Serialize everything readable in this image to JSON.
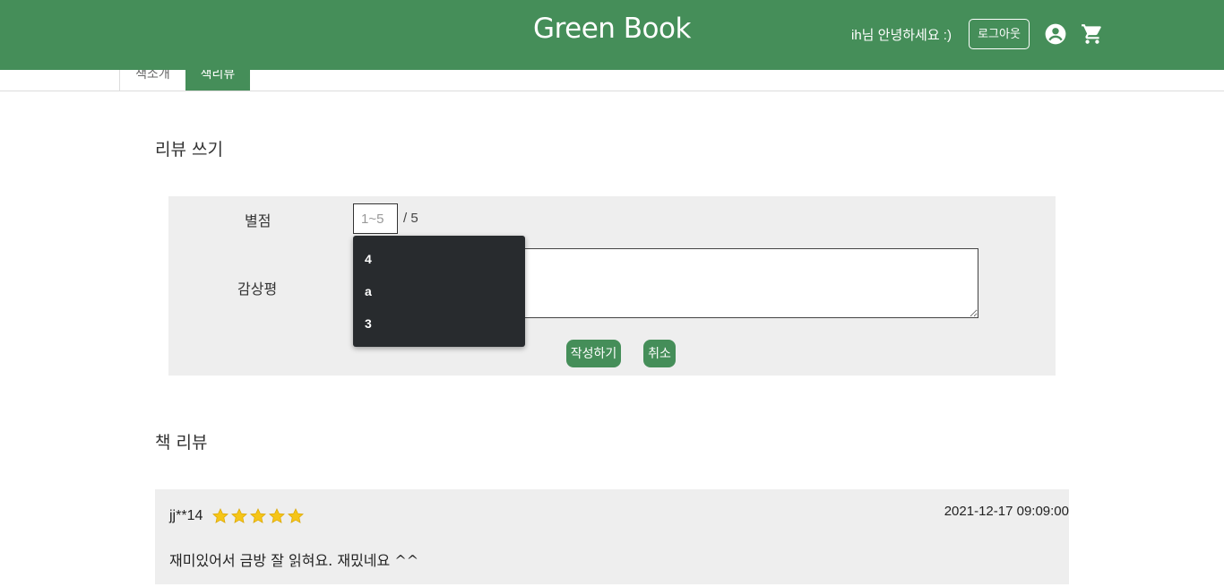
{
  "header": {
    "brand": "Green Book",
    "greeting": "ih님 안녕하세요 :)",
    "logout_label": "로그아웃",
    "icons": [
      "account-circle-icon",
      "cart-icon"
    ]
  },
  "tabs": [
    {
      "label": "책소개"
    },
    {
      "label": "책리뷰"
    }
  ],
  "write_section": {
    "title": "리뷰 쓰기",
    "rating_label": "별점",
    "rating_placeholder": "1~5",
    "rating_max": "/ 5",
    "comment_label": "감상평",
    "autocomplete_options": [
      "4",
      "a",
      "3"
    ],
    "submit_label": "작성하기",
    "cancel_label": "취소"
  },
  "reviews_section": {
    "title": "책 리뷰",
    "reviews": [
      {
        "user": "jj**14",
        "stars": 5,
        "date": "2021-12-17 09:09:00",
        "text": "재미있어서 금방 잘 읽혀요. 재밌네요 ^^"
      }
    ]
  },
  "colors": {
    "primary": "#458e59",
    "panel": "#eeeeee",
    "dropdown": "#282b2e",
    "star": "#f5c518"
  }
}
